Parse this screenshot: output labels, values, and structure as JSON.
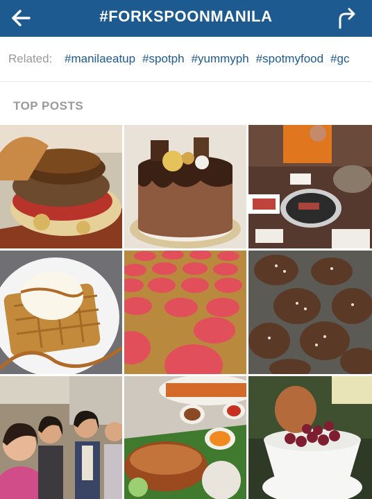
{
  "header": {
    "title": "#FORKSPOONMANILA",
    "back_icon": "arrow-left-icon",
    "share_icon": "share-arrow-icon",
    "color": "#1c5a8f"
  },
  "related": {
    "label": "Related:",
    "tags": [
      "#manilaeatup",
      "#spotph",
      "#yummyph",
      "#spotmyfood",
      "#gc"
    ]
  },
  "section_title": "TOP POSTS",
  "posts": [
    {
      "subject": "burger"
    },
    {
      "subject": "chocolate cake"
    },
    {
      "subject": "korean barbecue"
    },
    {
      "subject": "waffle with ice cream"
    },
    {
      "subject": "macarons"
    },
    {
      "subject": "grilled chicken"
    },
    {
      "subject": "group selfie"
    },
    {
      "subject": "crispy pork with rice"
    },
    {
      "subject": "shaved ice dessert"
    }
  ]
}
